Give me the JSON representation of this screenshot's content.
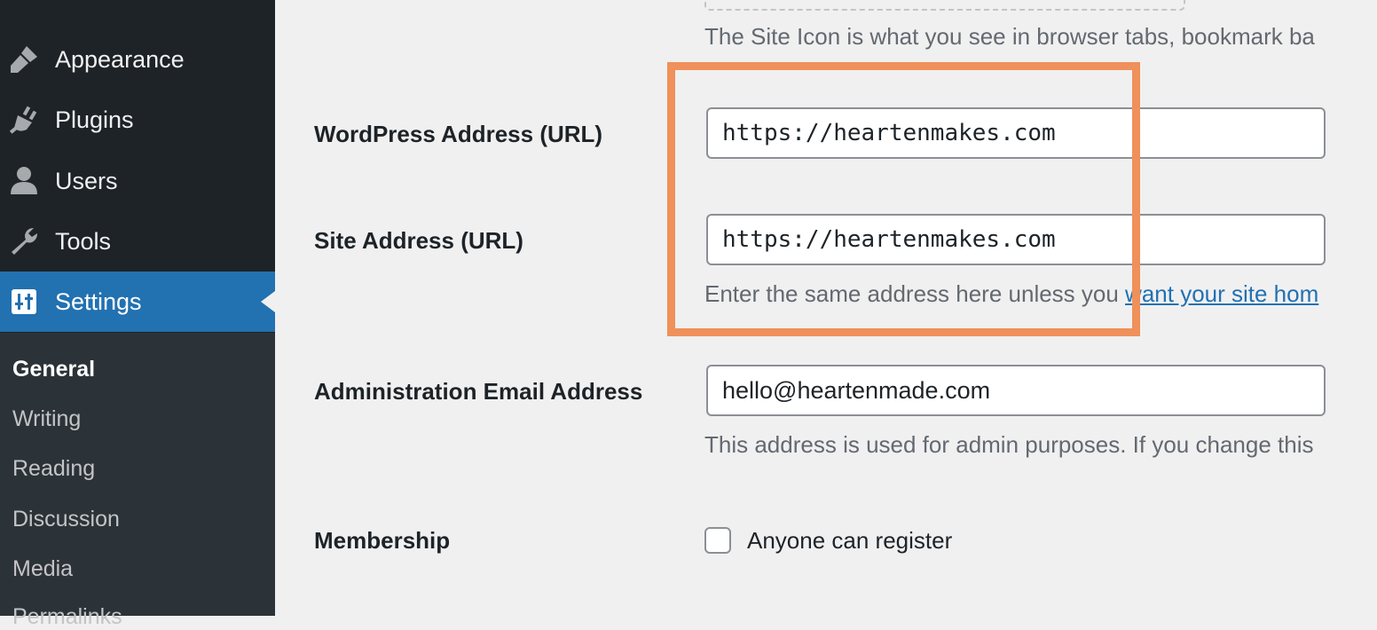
{
  "sidebar": {
    "menu": [
      {
        "label": "Appearance",
        "icon": "paintbrush-icon"
      },
      {
        "label": "Plugins",
        "icon": "plug-icon"
      },
      {
        "label": "Users",
        "icon": "user-icon"
      },
      {
        "label": "Tools",
        "icon": "wrench-icon"
      },
      {
        "label": "Settings",
        "icon": "settings-sliders-icon",
        "active": true
      }
    ],
    "submenu": [
      {
        "label": "General",
        "current": true
      },
      {
        "label": "Writing"
      },
      {
        "label": "Reading"
      },
      {
        "label": "Discussion"
      },
      {
        "label": "Media"
      },
      {
        "label": "Permalinks"
      }
    ]
  },
  "form": {
    "site_icon_desc": "The Site Icon is what you see in browser tabs, bookmark ba",
    "wp_address": {
      "label": "WordPress Address (URL)",
      "value": "https://heartenmakes.com"
    },
    "site_address": {
      "label": "Site Address (URL)",
      "value": "https://heartenmakes.com",
      "desc": "Enter the same address here unless you ",
      "desc_link": "want your site hom"
    },
    "admin_email": {
      "label": "Administration Email Address",
      "value": "hello@heartenmade.com",
      "desc": "This address is used for admin purposes. If you change this"
    },
    "membership": {
      "label": "Membership",
      "checkbox_label": "Anyone can register"
    }
  },
  "colors": {
    "sidebar_bg": "#1d2327",
    "active_bg": "#2271b1",
    "highlight": "#f0905a"
  }
}
